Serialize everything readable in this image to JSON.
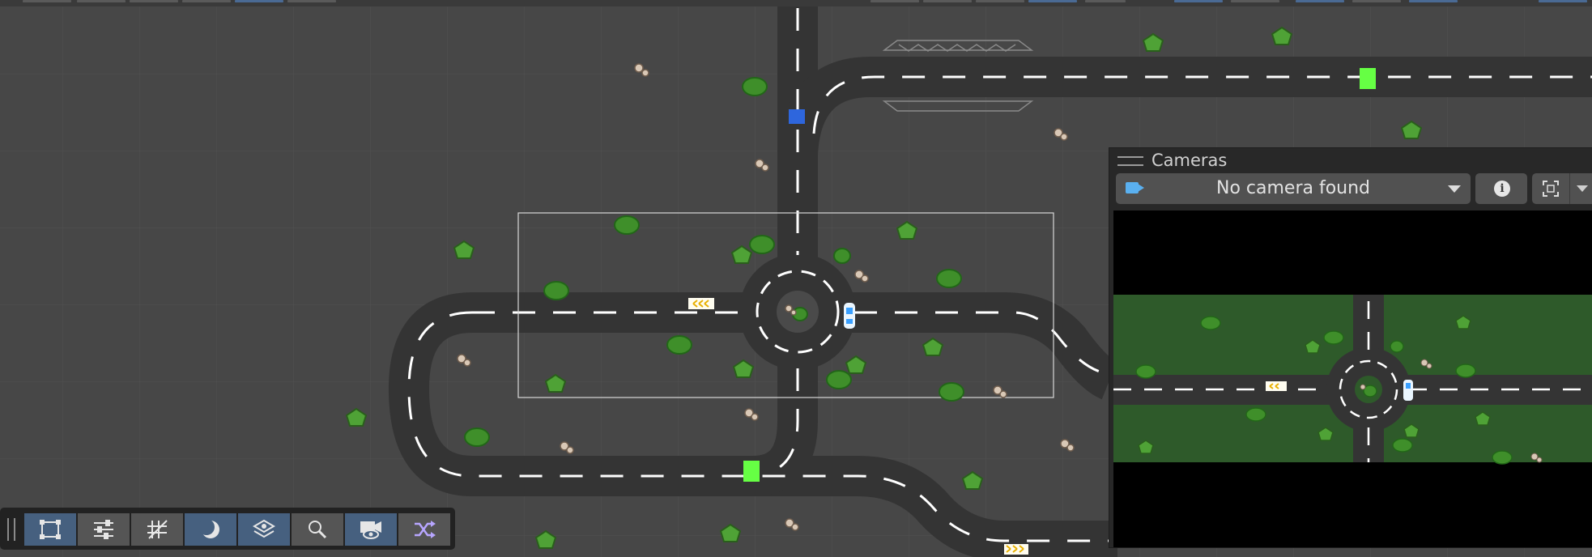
{
  "cameras_panel": {
    "title": "Cameras",
    "selected_camera": "No camera found",
    "icons": [
      "video-camera-icon",
      "chevron-down-icon",
      "info-icon",
      "frame-selection-icon"
    ]
  },
  "toolbar": {
    "tools": [
      {
        "name": "rect-tool",
        "icon": "rect-transform-icon",
        "active": true
      },
      {
        "name": "settings-tool",
        "icon": "sliders-icon",
        "active": false
      },
      {
        "name": "grid-tool",
        "icon": "grid-snap-icon",
        "active": false
      },
      {
        "name": "shading-tool",
        "icon": "moon-icon",
        "active": true
      },
      {
        "name": "layers-tool",
        "icon": "layers-icon",
        "active": true
      },
      {
        "name": "search-tool",
        "icon": "magnifier-icon",
        "active": false
      },
      {
        "name": "scene-camera-tool",
        "icon": "camera-eye-icon",
        "active": true
      },
      {
        "name": "shuffle-tool",
        "icon": "shuffle-icon",
        "active": false
      }
    ]
  },
  "colors": {
    "scene_bg": "#474747",
    "road": "#343434",
    "lane_marking": "#ffffff",
    "selection": "#d8d8d8",
    "accent_active": "#46607f",
    "grass": "#2e5a2a",
    "marker_green": "#66ff44",
    "marker_blue": "#2e66dd"
  }
}
